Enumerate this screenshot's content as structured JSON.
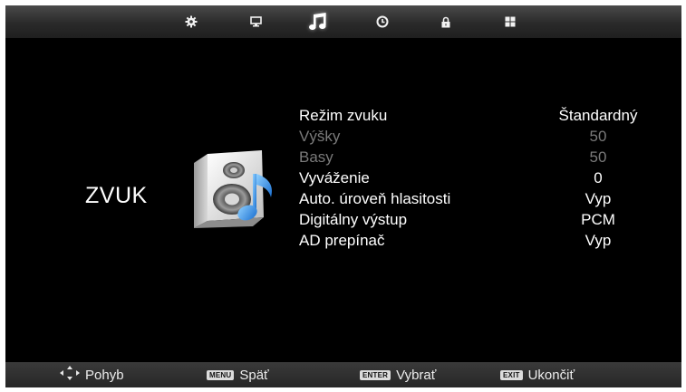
{
  "top_tabs": [
    {
      "icon": "gear-icon",
      "active": false
    },
    {
      "icon": "monitor-icon",
      "active": false
    },
    {
      "icon": "music-note-icon",
      "active": true
    },
    {
      "icon": "clock-icon",
      "active": false
    },
    {
      "icon": "lock-icon",
      "active": false
    },
    {
      "icon": "apps-grid-icon",
      "active": false
    }
  ],
  "page": {
    "title": "ZVUK",
    "icon": "speaker-music-icon"
  },
  "menu": [
    {
      "label": "Režim zvuku",
      "value": "Štandardný",
      "enabled": true
    },
    {
      "label": "Výšky",
      "value": "50",
      "enabled": false
    },
    {
      "label": "Basy",
      "value": "50",
      "enabled": false
    },
    {
      "label": "Vyváženie",
      "value": "0",
      "enabled": true
    },
    {
      "label": "Auto. úroveň hlasitosti",
      "value": "Vyp",
      "enabled": true
    },
    {
      "label": "Digitálny výstup",
      "value": "PCM",
      "enabled": true
    },
    {
      "label": "AD prepínač",
      "value": "Vyp",
      "enabled": true
    }
  ],
  "footer": {
    "move": {
      "icon": "arrows-icon",
      "label": "Pohyb"
    },
    "back": {
      "key": "MENU",
      "label": "Späť"
    },
    "select": {
      "key": "ENTER",
      "label": "Vybrať"
    },
    "exit": {
      "key": "EXIT",
      "label": "Ukončiť"
    }
  },
  "colors": {
    "background": "#000000",
    "text": "#ffffff",
    "disabled_text": "#7a7a7a",
    "accent_blue": "#2f8fe0"
  }
}
